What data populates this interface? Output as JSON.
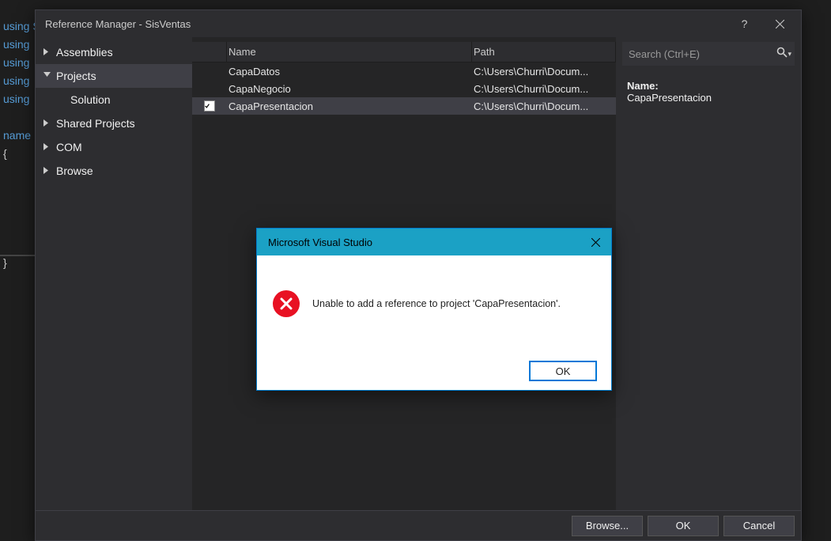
{
  "editor": {
    "lines": [
      "using System;",
      "using",
      "using",
      "using",
      "using",
      "",
      "name",
      "{",
      "",
      "",
      "",
      "",
      "",
      "}"
    ]
  },
  "refman": {
    "title": "Reference Manager - SisVentas",
    "sidebar": {
      "items": [
        {
          "label": "Assemblies",
          "expanded": false
        },
        {
          "label": "Projects",
          "expanded": true,
          "selected": true,
          "sub": [
            {
              "label": "Solution"
            }
          ]
        },
        {
          "label": "Shared Projects",
          "expanded": false
        },
        {
          "label": "COM",
          "expanded": false
        },
        {
          "label": "Browse",
          "expanded": false
        }
      ]
    },
    "search": {
      "placeholder": "Search (Ctrl+E)"
    },
    "list": {
      "headers": {
        "name": "Name",
        "path": "Path"
      },
      "rows": [
        {
          "checked": false,
          "name": "CapaDatos",
          "path": "C:\\Users\\Churri\\Docum..."
        },
        {
          "checked": false,
          "name": "CapaNegocio",
          "path": "C:\\Users\\Churri\\Docum..."
        },
        {
          "checked": true,
          "selected": true,
          "name": "CapaPresentacion",
          "path": "C:\\Users\\Churri\\Docum..."
        }
      ]
    },
    "info": {
      "name_label": "Name:",
      "name_value": "CapaPresentacion"
    },
    "footer": {
      "browse": "Browse...",
      "ok": "OK",
      "cancel": "Cancel"
    }
  },
  "errdlg": {
    "title": "Microsoft Visual Studio",
    "message": "Unable to add a reference to project 'CapaPresentacion'.",
    "ok": "OK"
  }
}
